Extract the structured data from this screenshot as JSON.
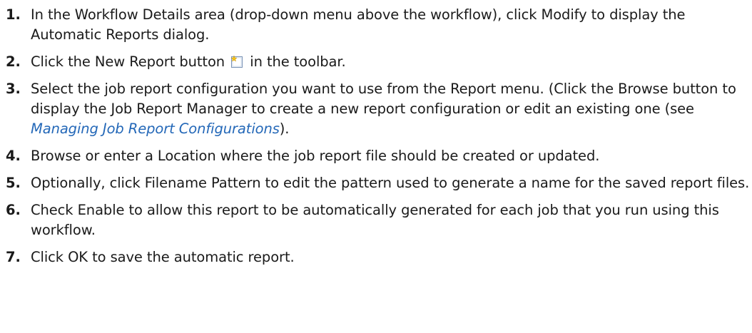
{
  "steps": [
    {
      "num": "1.",
      "text": "In the Workflow Details area (drop-down menu above the workflow), click Modify to display the Automatic Reports dialog."
    },
    {
      "num": "2.",
      "before": "Click the New Report button",
      "icon": "new-report-icon",
      "after": " in the toolbar."
    },
    {
      "num": "3.",
      "before": "Select the job report configuration you want to use from the Report menu. (Click the Browse button to display the Job Report Manager to create a new report configuration or edit an existing one (see ",
      "link": "Managing Job Report Configurations",
      "after": ")."
    },
    {
      "num": "4.",
      "text": "Browse or enter a Location where the job report file should be created or updated."
    },
    {
      "num": "5.",
      "text": "Optionally, click Filename Pattern to edit the pattern used to generate a name for the saved report files."
    },
    {
      "num": "6.",
      "text": "Check Enable to allow this report to be automatically generated for each job that you run using this workflow."
    },
    {
      "num": "7.",
      "text": "Click OK to save the automatic report."
    }
  ],
  "colors": {
    "link": "#2468b8",
    "text": "#1a1a1a"
  }
}
